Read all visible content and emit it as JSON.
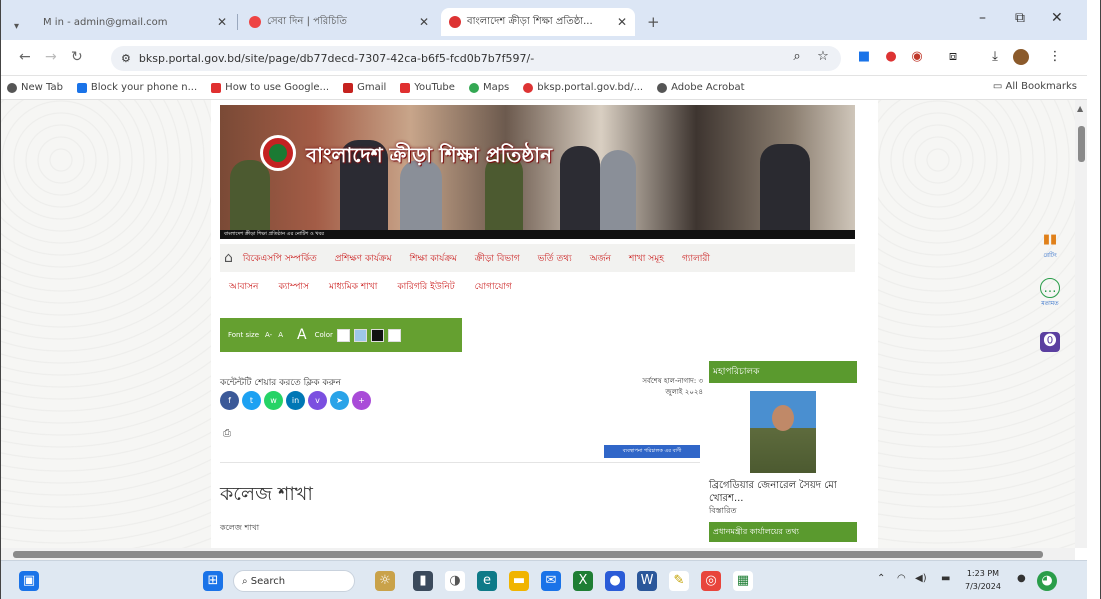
{
  "browser": {
    "tabs": [
      {
        "label": "M  in - admin@gmail.com",
        "active": false,
        "favicon_color": "#c5221f"
      },
      {
        "label": "সেবা দিন | পরিচিতি",
        "active": false,
        "favicon_color": "#e44"
      },
      {
        "label": "বাংলাদেশ ক্রীড়া শিক্ষা প্রতিষ্ঠা...",
        "active": true,
        "favicon_color": "#d33"
      }
    ],
    "new_tab": "+",
    "window_controls": {
      "minimize": "–",
      "restore": "⧉",
      "close": "✕"
    },
    "nav": {
      "back": "←",
      "forward": "→",
      "reload": "↻"
    },
    "url": "bksp.portal.gov.bd/site/page/db77decd-7307-42ca-b6f5-fcd0b7b7f597/-",
    "bookmarks": [
      {
        "label": "New Tab",
        "color": "#555"
      },
      {
        "label": "Block your phone n...",
        "color": "#1a73e8"
      },
      {
        "label": "How to use Google...",
        "color": "#e03030"
      },
      {
        "label": "Gmail",
        "color": "#c5221f"
      },
      {
        "label": "YouTube",
        "color": "#e03030"
      },
      {
        "label": "Maps",
        "color": "#34a853"
      },
      {
        "label": "bksp.portal.gov.bd/...",
        "color": "#d33"
      },
      {
        "label": "Adobe Acrobat",
        "color": "#555"
      }
    ],
    "all_bookmarks": "All Bookmarks"
  },
  "site": {
    "banner_title": "বাংলাদেশ ক্রীড়া শিক্ষা প্রতিষ্ঠান",
    "marquee": "বাংলাদেশ ক্রীড়া শিক্ষা প্রতিষ্ঠান এর নোটিশ ও খবর",
    "home_icon": "⌂",
    "main_nav": [
      "বিকেএসপি সম্পর্কিত",
      "প্রশিক্ষণ কার্যক্রম",
      "শিক্ষা কার্যক্রম",
      "ক্রীড়া বিভাগ",
      "ভর্তি তথ্য",
      "অর্জন",
      "শাখা সমূহ",
      "গ্যালারী"
    ],
    "sub_nav": [
      "আবাসন",
      "ক্যাম্পাস",
      "মাধ্যমিক শাখা",
      "কারিগরি ইউনিট",
      "যোগাযোগ"
    ],
    "a11y": {
      "font_label": "Font size",
      "minus": "A-",
      "normal": "A",
      "plus": "A",
      "color_label": "Color"
    },
    "share_title": "কন্টেন্টটি শেয়ার করতে ক্লিক করুন",
    "updated_text": "সর্বশেষ হাল-নাগাদ: ৩ জুলাই ২০২৪",
    "badge_text": "ব্যবস্থাপনা পরিচালক এর বাণী",
    "print_icon": "⎙",
    "page_title": "কলেজ শাখা",
    "page_sub": "কলেজ শাখা",
    "sidebar_head": "মহাপরিচালক",
    "person_name": "ব্রিগেডিয়ার জেনারেল সৈয়দ মো খোরশ...",
    "person_more": "বিস্তারিত",
    "sidebar_head2": "প্রধানমন্ত্রীর কার্যালয়ের তথ্য"
  },
  "right_widgets": [
    {
      "label": "রেটিং",
      "icon": "▮▮",
      "color": "#e0801a"
    },
    {
      "label": "মতামত",
      "icon": "💬",
      "color": "#2a9d4a"
    },
    {
      "label": "",
      "icon": "⓿",
      "color": "#5b3fa0"
    }
  ],
  "taskbar": {
    "search_placeholder": "Search",
    "time": "1:23 PM",
    "date": "7/3/2024"
  }
}
